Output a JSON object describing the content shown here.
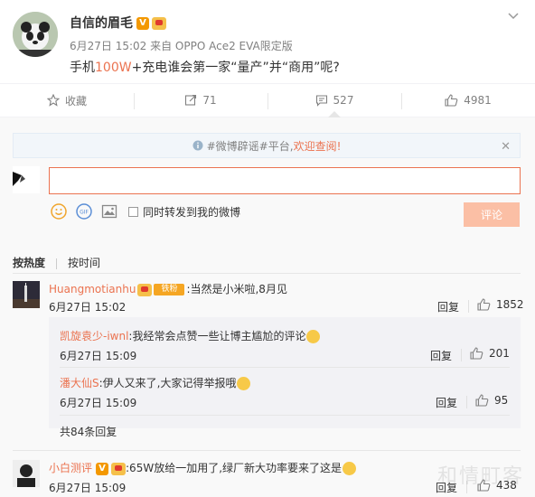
{
  "post": {
    "author": "自信的眉毛",
    "v_badge": "V",
    "meta": "6月27日 15:02 来自 OPPO Ace2 EVA限定版",
    "text_prefix": "手机",
    "text_highlight": "100W",
    "text_suffix": "+充电谁会第一家“量产”并“商用”呢?"
  },
  "actions": [
    {
      "icon": "star-icon",
      "label": "收藏"
    },
    {
      "icon": "share-icon",
      "label": "71"
    },
    {
      "icon": "comment-icon",
      "label": "527"
    },
    {
      "icon": "like-icon",
      "label": "4981"
    }
  ],
  "notice": {
    "hashtag": "#微博辟谣#平台,",
    "link": "欢迎查阅!",
    "close": "✕"
  },
  "reply_box": {
    "forward_label": "同时转发到我的微博",
    "submit": "评论"
  },
  "sort": {
    "hot": "按热度",
    "time": "按时间"
  },
  "comments": [
    {
      "user": "Huangmotianhu",
      "badge": "铁粉",
      "text": ":当然是小米啦,8月见",
      "time": "6月27日 15:02",
      "reply": "回复",
      "likes": "1852"
    },
    {
      "user": "小白测评",
      "v_badge": "V",
      "text": ":65W放给一加用了,绿厂新大功率要来了这是",
      "time": "6月27日 15:09",
      "reply": "回复",
      "likes": "438"
    }
  ],
  "subreplies": [
    {
      "user": "凯旋袁少-iwnl",
      "text": ":我经常会点赞一些让博主尴尬的评论",
      "time": "6月27日 15:09",
      "reply": "回复",
      "likes": "201"
    },
    {
      "user": "潘大仙S",
      "text": ":伊人又来了,大家记得举报哦",
      "time": "6月27日 15:09",
      "reply": "回复",
      "likes": "95"
    }
  ],
  "more_replies": "共84条回复",
  "watermark": "和情町客",
  "colors": {
    "accent": "#eb7350",
    "muted": "#808080",
    "submit_disabled": "#fbbfa5"
  }
}
